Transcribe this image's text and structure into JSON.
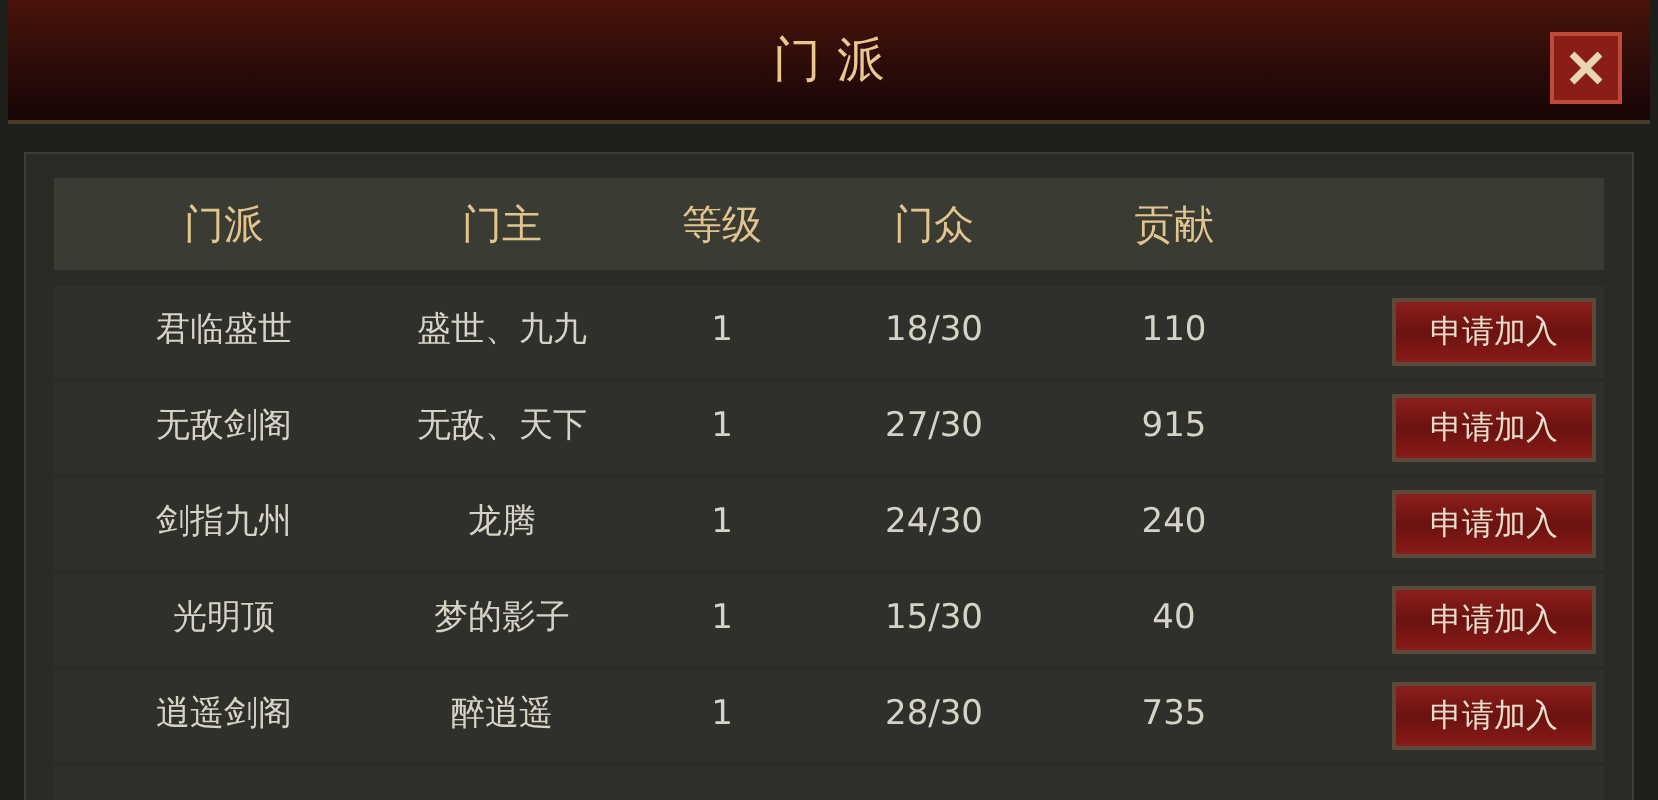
{
  "window": {
    "title": "门 派"
  },
  "table": {
    "columns": [
      "门派",
      "门主",
      "等级",
      "门众",
      "贡献"
    ],
    "rows": [
      {
        "cells": [
          "君临盛世",
          "盛世、九九",
          "1",
          "18/30",
          "110"
        ],
        "action": "申请加入"
      },
      {
        "cells": [
          "无敌剑阁",
          "无敌、天下",
          "1",
          "27/30",
          "915"
        ],
        "action": "申请加入"
      },
      {
        "cells": [
          "剑指九州",
          "龙腾",
          "1",
          "24/30",
          "240"
        ],
        "action": "申请加入"
      },
      {
        "cells": [
          "光明顶",
          "梦的影子",
          "1",
          "15/30",
          "40"
        ],
        "action": "申请加入"
      },
      {
        "cells": [
          "逍遥剑阁",
          "醉逍遥",
          "1",
          "28/30",
          "735"
        ],
        "action": "申请加入"
      }
    ]
  }
}
